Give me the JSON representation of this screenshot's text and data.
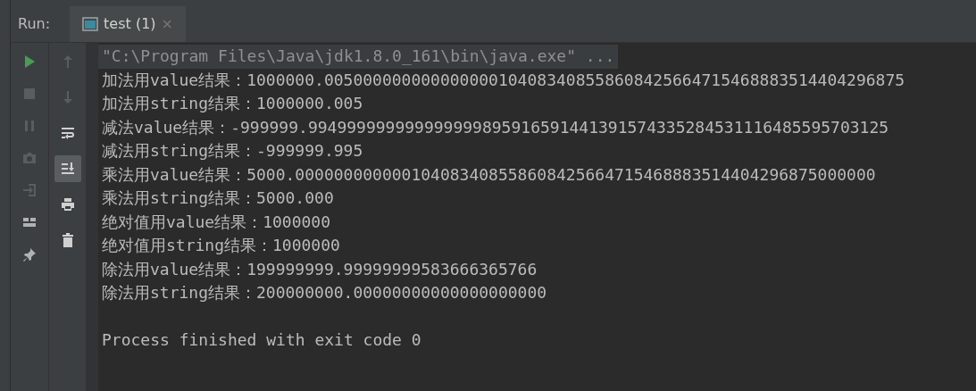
{
  "run_panel": {
    "label": "Run:",
    "tabs": [
      {
        "label": "test (1)",
        "close": "×",
        "selected": true
      }
    ]
  },
  "left_toolbar": [
    {
      "kind": "run",
      "disabled": false
    },
    {
      "kind": "stop",
      "disabled": true
    },
    {
      "kind": "pause",
      "disabled": true
    },
    {
      "kind": "camera",
      "disabled": true
    },
    {
      "kind": "exit",
      "disabled": true
    },
    {
      "kind": "layout",
      "disabled": false
    },
    {
      "kind": "pin",
      "disabled": false
    }
  ],
  "right_toolbar": [
    {
      "kind": "up",
      "disabled": true,
      "selected": false
    },
    {
      "kind": "down",
      "disabled": true,
      "selected": false
    },
    {
      "kind": "wrap",
      "disabled": false,
      "selected": false
    },
    {
      "kind": "scroll-end",
      "disabled": false,
      "selected": true
    },
    {
      "kind": "print",
      "disabled": false,
      "selected": false
    },
    {
      "kind": "trash",
      "disabled": false,
      "selected": false
    }
  ],
  "console": [
    {
      "kind": "command",
      "text": "\"C:\\Program Files\\Java\\jdk1.8.0_161\\bin\\java.exe\" ..."
    },
    {
      "kind": "output",
      "text": "加法用value结果：1000000.005000000000000000104083408558608425664715468883514404296875"
    },
    {
      "kind": "output",
      "text": "加法用string结果：1000000.005"
    },
    {
      "kind": "output",
      "text": "减法value结果：-999999.994999999999999999895916591441391574335284531116485595703125"
    },
    {
      "kind": "output",
      "text": "减法用string结果：-999999.995"
    },
    {
      "kind": "output",
      "text": "乘法用value结果：5000.000000000000104083408558608425664715468883514404296875000000"
    },
    {
      "kind": "output",
      "text": "乘法用string结果：5000.000"
    },
    {
      "kind": "output",
      "text": "绝对值用value结果：1000000"
    },
    {
      "kind": "output",
      "text": "绝对值用string结果：1000000"
    },
    {
      "kind": "output",
      "text": "除法用value结果：199999999.99999999583666365766"
    },
    {
      "kind": "output",
      "text": "除法用string结果：200000000.00000000000000000000"
    },
    {
      "kind": "blank"
    },
    {
      "kind": "output",
      "text": "Process finished with exit code 0"
    }
  ]
}
